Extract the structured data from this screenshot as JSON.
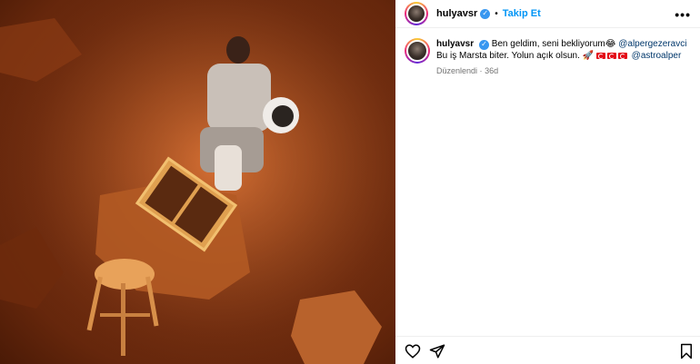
{
  "post": {
    "author": {
      "username": "hulyavsr",
      "verified": true,
      "follow_label": "Takip Et",
      "separator": "•"
    },
    "more_menu": "•••",
    "caption": {
      "username": "hulyavsr",
      "text_1": "Ben geldim, seni bekliyorum",
      "emoji_1": "😂",
      "mention_1": "@alpergezeravci",
      "text_2": "Bu iş Marsta biter. Yolun açık olsun.",
      "emoji_2": "🚀",
      "flag_count": 3,
      "mention_2": "@astroalper",
      "edited_label": "Düzenlendi",
      "meta_separator": "·",
      "age": "36d"
    },
    "actions": [
      "heart-icon",
      "share-icon",
      "bookmark-icon"
    ]
  },
  "colors": {
    "link": "#0095f6",
    "mention": "#00376b",
    "verified": "#3897f0",
    "muted": "#737373"
  }
}
